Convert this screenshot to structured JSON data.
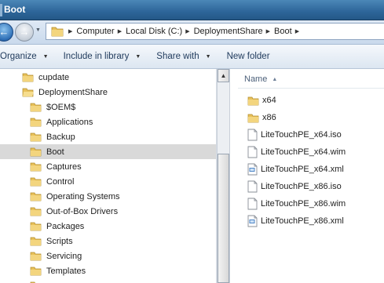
{
  "window": {
    "title": "Boot"
  },
  "address": {
    "breadcrumbs": [
      "Computer",
      "Local Disk (C:)",
      "DeploymentShare",
      "Boot"
    ]
  },
  "toolbar": {
    "organize": "Organize",
    "include_in_library": "Include in library",
    "share_with": "Share with",
    "new_folder": "New folder"
  },
  "nav_tree": {
    "items": [
      {
        "label": "cupdate",
        "level": 1
      },
      {
        "label": "DeploymentShare",
        "level": 1
      },
      {
        "label": "$OEM$",
        "level": 2
      },
      {
        "label": "Applications",
        "level": 2
      },
      {
        "label": "Backup",
        "level": 2
      },
      {
        "label": "Boot",
        "level": 2,
        "selected": true
      },
      {
        "label": "Captures",
        "level": 2
      },
      {
        "label": "Control",
        "level": 2
      },
      {
        "label": "Operating Systems",
        "level": 2
      },
      {
        "label": "Out-of-Box Drivers",
        "level": 2
      },
      {
        "label": "Packages",
        "level": 2
      },
      {
        "label": "Scripts",
        "level": 2
      },
      {
        "label": "Servicing",
        "level": 2
      },
      {
        "label": "Templates",
        "level": 2
      }
    ]
  },
  "file_list": {
    "column_name": "Name",
    "items": [
      {
        "name": "x64",
        "icon": "folder-icon"
      },
      {
        "name": "x86",
        "icon": "folder-icon"
      },
      {
        "name": "LiteTouchPE_x64.iso",
        "icon": "file-icon"
      },
      {
        "name": "LiteTouchPE_x64.wim",
        "icon": "file-icon"
      },
      {
        "name": "LiteTouchPE_x64.xml",
        "icon": "xml-file-icon"
      },
      {
        "name": "LiteTouchPE_x86.iso",
        "icon": "file-icon"
      },
      {
        "name": "LiteTouchPE_x86.wim",
        "icon": "file-icon"
      },
      {
        "name": "LiteTouchPE_x86.xml",
        "icon": "xml-file-icon"
      }
    ]
  },
  "colors": {
    "titlebar": "#2d6599",
    "selection": "#d9d9d9",
    "folder": "#e8c15a"
  }
}
